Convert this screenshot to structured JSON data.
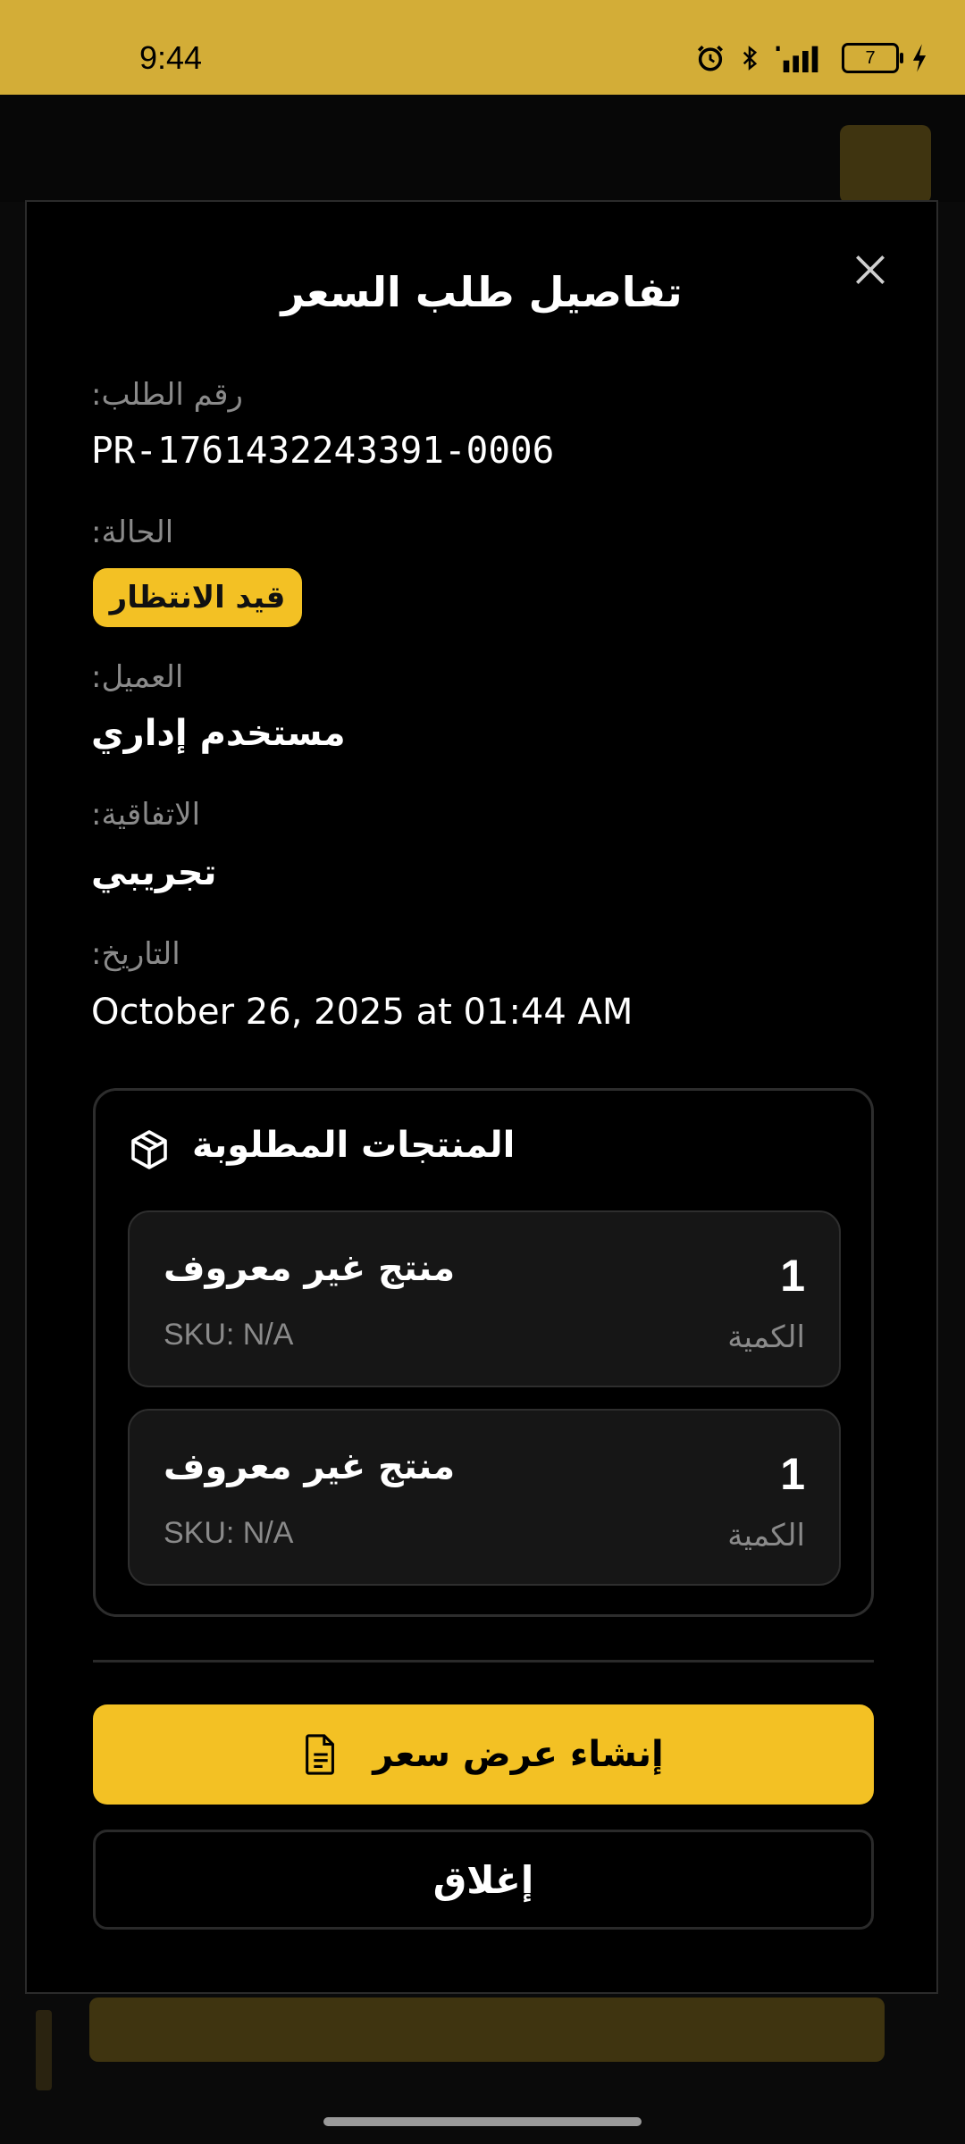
{
  "status_bar": {
    "time": "9:44",
    "battery": "7"
  },
  "modal": {
    "title": "تفاصيل طلب السعر",
    "fields": {
      "order_number": {
        "label": "رقم الطلب:",
        "value": "PR-1761432243391-0006"
      },
      "status": {
        "label": "الحالة:",
        "value": "قيد الانتظار"
      },
      "customer": {
        "label": "العميل:",
        "value": "مستخدم إداري"
      },
      "agreement": {
        "label": "الاتفاقية:",
        "value": "تجريبي"
      },
      "date": {
        "label": "التاريخ:",
        "value": "October 26, 2025 at 01:44 AM"
      }
    },
    "products": {
      "title": "المنتجات المطلوبة",
      "items": [
        {
          "name": "منتج غير معروف",
          "sku": "SKU: N/A",
          "qty": "1",
          "qty_label": "الكمية"
        },
        {
          "name": "منتج غير معروف",
          "sku": "SKU: N/A",
          "qty": "1",
          "qty_label": "الكمية"
        }
      ]
    },
    "primary_button": "إنشاء عرض سعر",
    "secondary_button": "إغلاق"
  },
  "colors": {
    "accent": "#f3c124",
    "status_bar": "#d3ad37",
    "background": "#000000"
  }
}
